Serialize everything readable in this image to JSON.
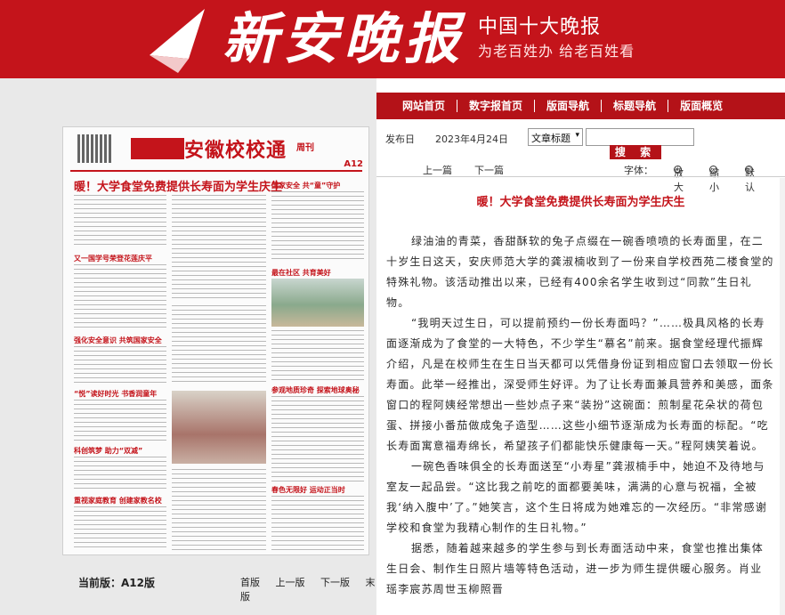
{
  "header": {
    "logo_text": "新安晚报",
    "slogan_main": "中国十大晚报",
    "slogan_sub": "为老百姓办 给老百姓看",
    "brand_color": "#c4141b"
  },
  "nav": {
    "items": [
      "网站首页",
      "数字报首页",
      "版面导航",
      "标题导航",
      "版面概览"
    ]
  },
  "search": {
    "date_label": "发布日",
    "date_value": "2023年4月24日",
    "select_value": "文章标题",
    "button_label": "搜 索",
    "input_value": ""
  },
  "pager": {
    "prev": "上一篇",
    "next": "下一篇",
    "font_label": "字体：",
    "zoom_in": "放大",
    "zoom_out": "缩小",
    "default": "默认"
  },
  "newspaper": {
    "masthead": "安徽校校通",
    "weekly": "周刊",
    "page_no": "A12",
    "headline": "暖！大学食堂免费提供长寿面为学生庆生",
    "sub1": "又一国学号荣登花莲庆平",
    "sub2": "强化安全意识 共筑国家安全",
    "sub3": "“悦”读好时光 书香润童年",
    "sub4": "科创筑梦 助力“双减”",
    "sub5": "重视家庭教育 创建家教名校",
    "sub6": "国家安全 共“童”守护",
    "sub7": "最在社区 共育美好",
    "sub8": "参观地质珍奇 探索地球奥秘",
    "sub9": "春色无限好 运动正当时"
  },
  "edition": {
    "current_label": "当前版：A12版",
    "links": [
      "首版",
      "上一版",
      "下一版",
      "末版"
    ]
  },
  "article": {
    "title": "暖！大学食堂免费提供长寿面为学生庆生",
    "paragraphs": [
      "绿油油的青菜，香甜酥软的兔子点缀在一碗香喷喷的长寿面里，在二十岁生日这天，安庆师范大学的龚淑楠收到了一份来自学校西苑二楼食堂的特殊礼物。该活动推出以来，已经有400余名学生收到过“同款”生日礼物。",
      "“我明天过生日，可以提前预约一份长寿面吗？”……极具风格的长寿面逐渐成为了食堂的一大特色，不少学生“慕名”前来。据食堂经理代振辉介绍，凡是在校师生在生日当天都可以凭借身份证到相应窗口去领取一份长寿面。此举一经推出，深受师生好评。为了让长寿面兼具营养和美感，面条窗口的程阿姨经常想出一些妙点子来“装扮”这碗面：煎制星花朵状的荷包蛋、拼接小番茄做成兔子造型……这些小细节逐渐成为长寿面的标配。“吃长寿面寓意福寿绵长，希望孩子们都能快乐健康每一天。”程阿姨笑着说。",
      "一碗色香味俱全的长寿面送至“小寿星”龚淑楠手中，她迫不及待地与室友一起品尝。“这比我之前吃的面都要美味，满满的心意与祝福，全被我‘纳入腹中’了。”她笑言，这个生日将成为她难忘的一次经历。“非常感谢学校和食堂为我精心制作的生日礼物。”",
      "据悉，随着越来越多的学生参与到长寿面活动中来，食堂也推出集体生日会、制作生日照片墙等特色活动，进一步为师生提供暖心服务。肖业 瑶李宸苏周世玉柳照晋"
    ]
  }
}
